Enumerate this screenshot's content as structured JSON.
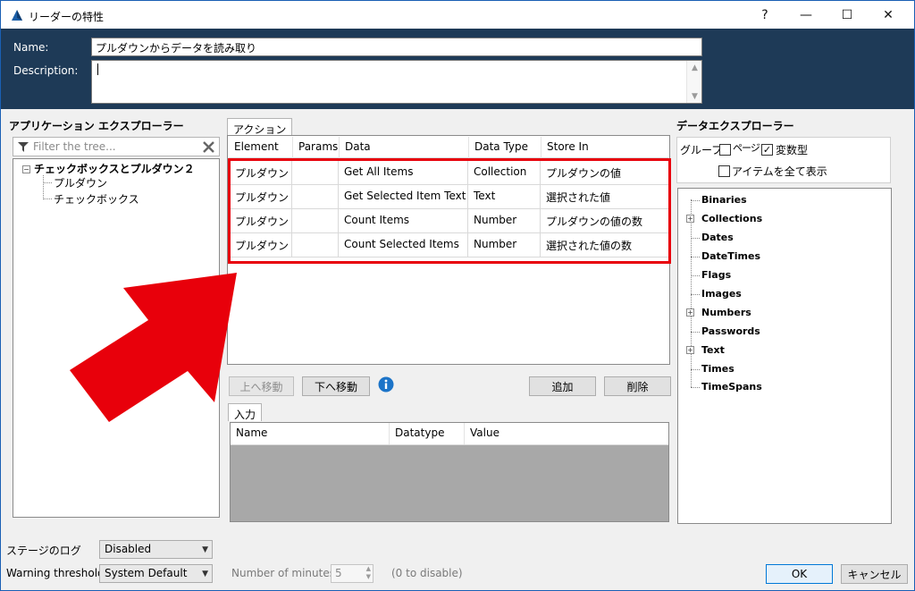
{
  "window": {
    "title": "リーダーの特性",
    "help_glyph": "?",
    "minimize_glyph": "—",
    "maximize_glyph": "☐",
    "close_glyph": "✕"
  },
  "header": {
    "name_label": "Name:",
    "name_value": "プルダウンからデータを読み取り",
    "description_label": "Description:",
    "description_value": ""
  },
  "explorer": {
    "title": "アプリケーション エクスプローラー",
    "filter_placeholder": "Filter the tree...",
    "tree": {
      "root": "チェックボックスとプルダウン２",
      "children": [
        "プルダウン",
        "チェックボックス"
      ]
    }
  },
  "actions": {
    "tab_label": "アクション",
    "columns": [
      "Element",
      "Params",
      "Data",
      "Data Type",
      "Store In"
    ],
    "rows": [
      [
        "プルダウン",
        "",
        "Get All Items",
        "Collection",
        "プルダウンの値"
      ],
      [
        "プルダウン",
        "",
        "Get Selected Item Text",
        "Text",
        "選択された値"
      ],
      [
        "プルダウン",
        "",
        "Count Items",
        "Number",
        "プルダウンの値の数"
      ],
      [
        "プルダウン",
        "",
        "Count Selected Items",
        "Number",
        "選択された値の数"
      ]
    ],
    "move_up_label": "上へ移動",
    "move_down_label": "下へ移動",
    "add_label": "追加",
    "delete_label": "削除"
  },
  "inputs": {
    "tab_label": "入力",
    "columns": [
      "Name",
      "Datatype",
      "Value"
    ]
  },
  "data_explorer": {
    "title": "データエクスプローラー",
    "group_label": "グループ",
    "page_label": "ページ",
    "page_checked": false,
    "var_type_label": "変数型",
    "var_type_checked": true,
    "show_all_label": "アイテムを全て表示",
    "show_all_checked": false,
    "items": [
      {
        "label": "Binaries",
        "expandable": false
      },
      {
        "label": "Collections",
        "expandable": true
      },
      {
        "label": "Dates",
        "expandable": false
      },
      {
        "label": "DateTimes",
        "expandable": false
      },
      {
        "label": "Flags",
        "expandable": false
      },
      {
        "label": "Images",
        "expandable": false
      },
      {
        "label": "Numbers",
        "expandable": true
      },
      {
        "label": "Passwords",
        "expandable": false
      },
      {
        "label": "Text",
        "expandable": true
      },
      {
        "label": "Times",
        "expandable": false
      },
      {
        "label": "TimeSpans",
        "expandable": false
      }
    ]
  },
  "footer": {
    "stage_log_label": "ステージのログ",
    "stage_log_value": "Disabled",
    "warning_label": "Warning threshold:",
    "warning_value": "System Default",
    "minutes_label": "Number of minutes",
    "minutes_value": "5",
    "minutes_hint": "(0 to disable)",
    "ok_label": "OK",
    "cancel_label": "キャンセル"
  },
  "colors": {
    "header_band": "#1e3a57",
    "highlight": "#e8000b",
    "arrow": "#e8000b"
  }
}
